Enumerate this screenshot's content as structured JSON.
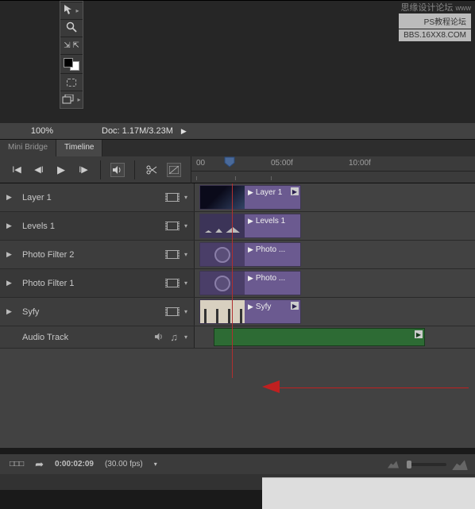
{
  "watermark": {
    "line1": "思缘设计论坛",
    "line2": "PS教程论坛",
    "line3": "BBS.16XX8.COM",
    "url": "www"
  },
  "zoombar": {
    "zoom": "100%",
    "doc": "Doc: 1.17M/3.23M"
  },
  "tabs": [
    {
      "label": "Mini Bridge"
    },
    {
      "label": "Timeline"
    }
  ],
  "ruler": {
    "t0": "00",
    "t1": "05:00f",
    "t2": "10:00f"
  },
  "tracks": [
    {
      "name": "Layer 1",
      "clipLabel": "Layer 1"
    },
    {
      "name": "Levels 1",
      "clipLabel": "Levels 1"
    },
    {
      "name": "Photo Filter 2",
      "clipLabel": "Photo ..."
    },
    {
      "name": "Photo Filter 1",
      "clipLabel": "Photo ..."
    },
    {
      "name": "Syfy",
      "clipLabel": "Syfy"
    }
  ],
  "audioTrack": {
    "name": "Audio Track"
  },
  "footer": {
    "timecode": "0:00:02:09",
    "fps": "(30.00 fps)",
    "corner": "□□□"
  }
}
